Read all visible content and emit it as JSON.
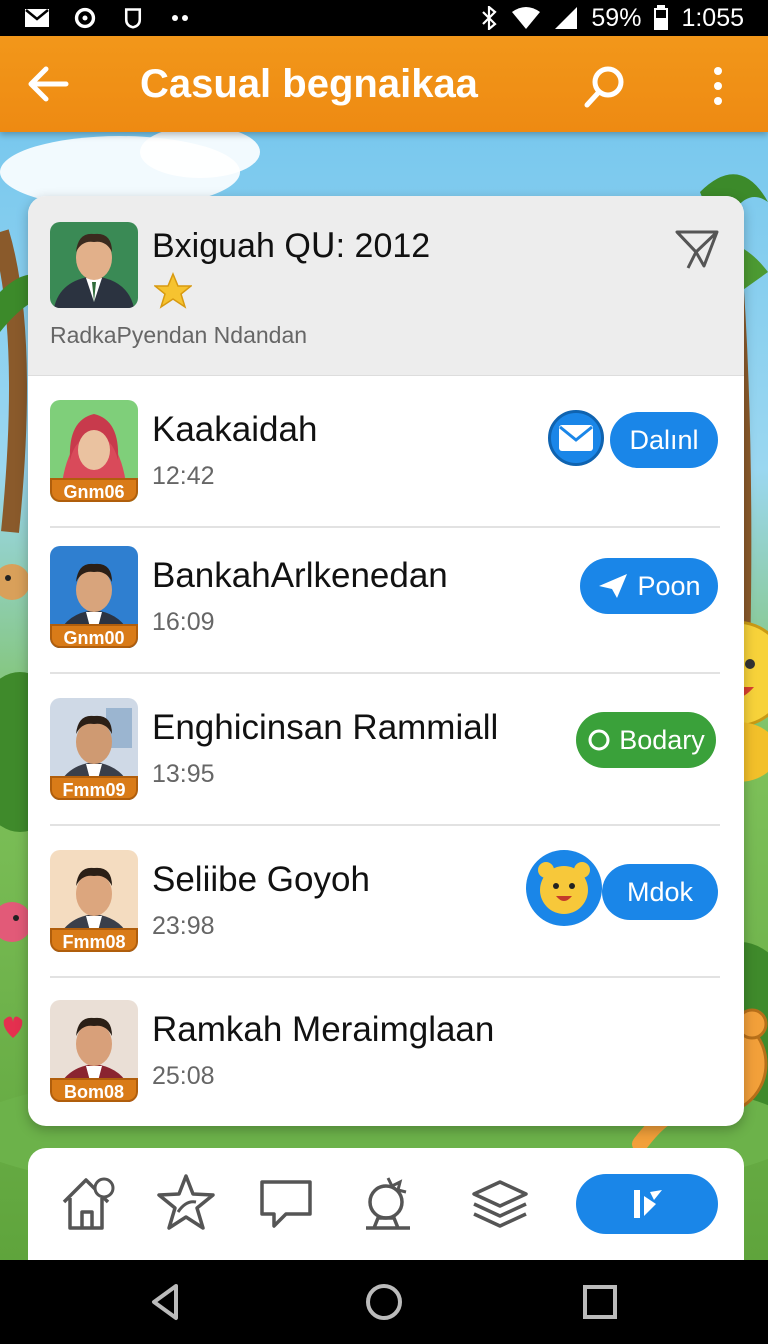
{
  "status_bar": {
    "battery": "59%",
    "time": "1:055"
  },
  "app_bar": {
    "title": "Casual begnaikaa"
  },
  "header": {
    "title": "Bxiguah QՍ: 2012",
    "subtitle": "RadkaPyendan Ndandan"
  },
  "contacts": [
    {
      "name": "Kaakaidah",
      "time": "12:42",
      "tag": "Gnm06",
      "action": "Dalınl",
      "extra": "mail"
    },
    {
      "name": "BankahArlkenedan",
      "time": "16:09",
      "tag": "Gnm00",
      "action": "Poon",
      "extra": ""
    },
    {
      "name": "Enghicinsan Rammiall",
      "time": "13:95",
      "tag": "Fmm09",
      "action": "Bodary",
      "extra": ""
    },
    {
      "name": "Seliibe Goyoh",
      "time": "23:98",
      "tag": "Fmm08",
      "action": "Mdok",
      "extra": "bear"
    },
    {
      "name": "Ramkah Meraimglaan",
      "time": "25:08",
      "tag": "Bom08",
      "action": "",
      "extra": ""
    }
  ],
  "bottom_nav": {
    "active_label": "K"
  },
  "colors": {
    "accent": "#ee8a12",
    "primary": "#1a86e8",
    "success": "#3aa13a"
  }
}
